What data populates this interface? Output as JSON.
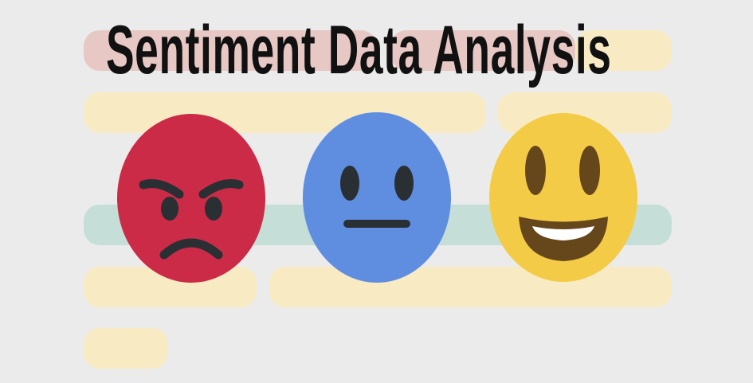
{
  "title": "Sentiment Data Analysis",
  "colors": {
    "background": "#ebebeb",
    "bar_red": "#e8c8c5",
    "bar_yellow": "#f8ebc4",
    "bar_teal": "#c5dfd8",
    "angry_face": "#cb2b47",
    "neutral_face": "#5f8ee0",
    "happy_face": "#f4cb47",
    "features": "#292f33",
    "happy_features": "#65471b"
  },
  "faces": [
    {
      "icon": "angry-face-icon"
    },
    {
      "icon": "neutral-face-icon"
    },
    {
      "icon": "grinning-face-icon"
    }
  ]
}
